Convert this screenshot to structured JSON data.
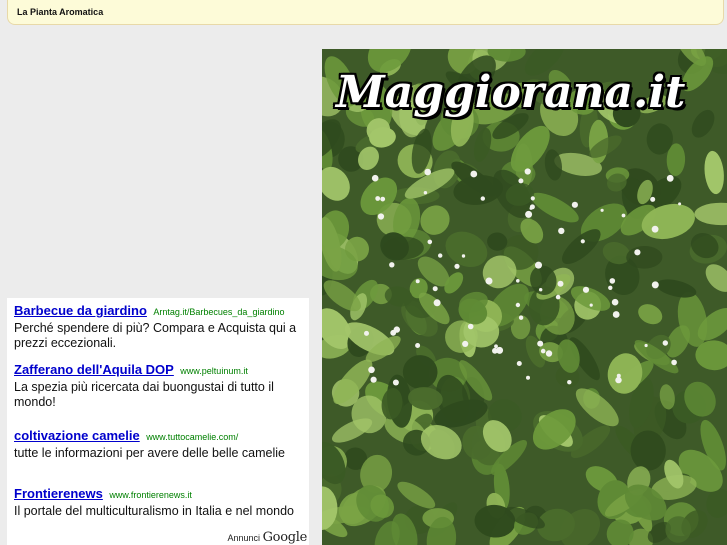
{
  "header": {
    "tagline": "La Pianta Aromatica"
  },
  "hero": {
    "logo_text": "Maggiorana.it",
    "image_subject": "marjoram-plant-photo"
  },
  "ads": {
    "items": [
      {
        "title": "Barbecue da giardino",
        "url": "Arntag.it/Barbecues_da_giardino",
        "desc": "Perché spendere di più? Compara e Acquista qui a prezzi eccezionali."
      },
      {
        "title": "Zafferano dell'Aquila DOP",
        "url": "www.peltuinum.it",
        "desc": "La spezia più ricercata dai buongustai di tutto il mondo!"
      },
      {
        "title": "coltivazione camelie",
        "url": "www.tuttocamelie.com/",
        "desc": "tutte le informazioni per avere delle belle camelie"
      },
      {
        "title": "Frontierenews",
        "url": "www.frontierenews.it",
        "desc": "Il portale del multiculturalismo in Italia e nel mondo"
      }
    ],
    "attribution_prefix": "Annunci",
    "attribution_brand": "Google"
  },
  "colors": {
    "link": "#0000cc",
    "url": "#008000",
    "header_bg": "#fdfbd8",
    "page_bg": "#ececec"
  }
}
